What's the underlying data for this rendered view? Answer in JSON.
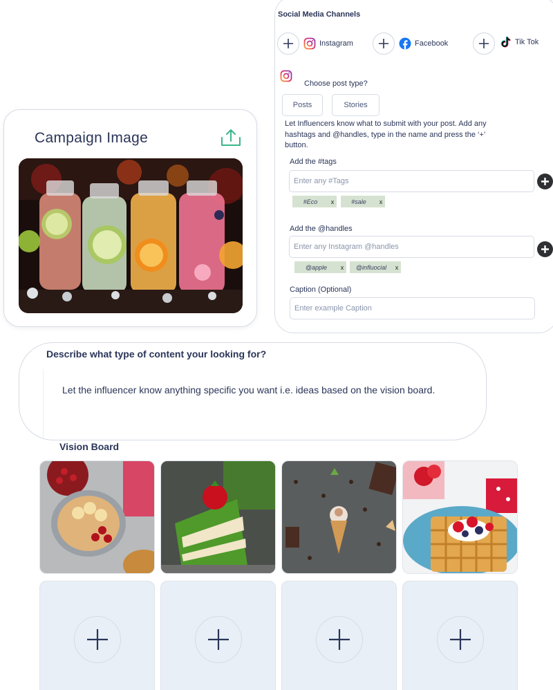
{
  "social": {
    "title": "Social Media Channels",
    "channels": [
      {
        "label": "Instagram",
        "icon": "instagram-icon"
      },
      {
        "label": "Facebook",
        "icon": "facebook-icon"
      },
      {
        "label": "Tik Tok",
        "icon": "tiktok-icon"
      }
    ],
    "choose_post_type": "Choose post type?",
    "post_types": [
      "Posts",
      "Stories"
    ],
    "instructions": "Let Influencers know what to submit with your post. Add any hashtags and @handles, type in the name and press the ‘+’ button.",
    "tags": {
      "label": "Add the #tags",
      "placeholder": "Enter any #Tags",
      "chips": [
        "#Eco",
        "#sale"
      ]
    },
    "handles": {
      "label": "Add the @handles",
      "placeholder": "Enter any Instagram @handles",
      "chips": [
        "@apple",
        "@influocial"
      ]
    },
    "caption": {
      "label": "Caption (Optional)",
      "placeholder": "Enter example Caption"
    },
    "chip_remove": "x"
  },
  "campaign": {
    "title": "Campaign Image",
    "upload_icon": "upload-icon"
  },
  "description": {
    "title": "Describe what type of content your looking for?",
    "placeholder": "Let the influencer know anything specific you want i.e. ideas based on the vision board."
  },
  "vision_board": {
    "title": "Vision Board",
    "images": [
      "cranberry-oat-bowl",
      "green-cake-strawberry",
      "ice-cream-cone",
      "waffles-berries"
    ],
    "add_slots": 4
  },
  "colors": {
    "primary_text": "#2a3558",
    "border": "#d6dbe4",
    "chip_bg": "#d6e2d1",
    "upload_accent": "#3cb58a",
    "add_slot_bg": "#e8eff7"
  }
}
